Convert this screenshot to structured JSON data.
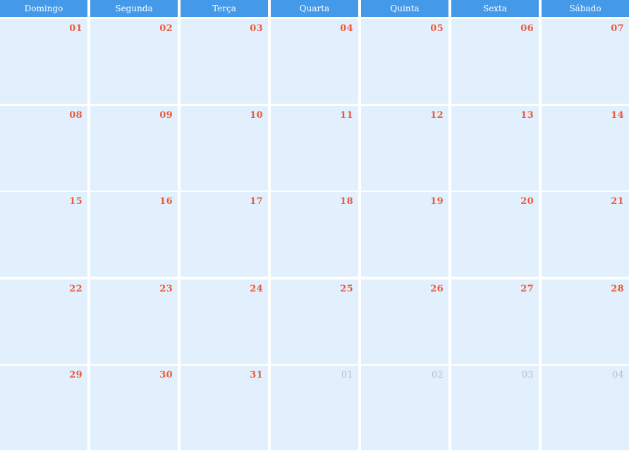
{
  "calendar": {
    "weekdays": [
      "Domingo",
      "Segunda",
      "Terça",
      "Quarta",
      "Quinta",
      "Sexta",
      "Sábado"
    ],
    "weeks": [
      {
        "days": [
          {
            "label": "01",
            "current_month": true
          },
          {
            "label": "02",
            "current_month": true
          },
          {
            "label": "03",
            "current_month": true
          },
          {
            "label": "04",
            "current_month": true
          },
          {
            "label": "05",
            "current_month": true
          },
          {
            "label": "06",
            "current_month": true
          },
          {
            "label": "07",
            "current_month": true
          }
        ]
      },
      {
        "days": [
          {
            "label": "08",
            "current_month": true
          },
          {
            "label": "09",
            "current_month": true
          },
          {
            "label": "10",
            "current_month": true
          },
          {
            "label": "11",
            "current_month": true
          },
          {
            "label": "12",
            "current_month": true
          },
          {
            "label": "13",
            "current_month": true
          },
          {
            "label": "14",
            "current_month": true
          }
        ]
      },
      {
        "days": [
          {
            "label": "15",
            "current_month": true
          },
          {
            "label": "16",
            "current_month": true
          },
          {
            "label": "17",
            "current_month": true
          },
          {
            "label": "18",
            "current_month": true
          },
          {
            "label": "19",
            "current_month": true
          },
          {
            "label": "20",
            "current_month": true
          },
          {
            "label": "21",
            "current_month": true
          }
        ]
      },
      {
        "days": [
          {
            "label": "22",
            "current_month": true
          },
          {
            "label": "23",
            "current_month": true
          },
          {
            "label": "24",
            "current_month": true
          },
          {
            "label": "25",
            "current_month": true
          },
          {
            "label": "26",
            "current_month": true
          },
          {
            "label": "27",
            "current_month": true
          },
          {
            "label": "28",
            "current_month": true
          }
        ]
      },
      {
        "days": [
          {
            "label": "29",
            "current_month": true
          },
          {
            "label": "30",
            "current_month": true
          },
          {
            "label": "31",
            "current_month": true
          },
          {
            "label": "01",
            "current_month": false
          },
          {
            "label": "02",
            "current_month": false
          },
          {
            "label": "03",
            "current_month": false
          },
          {
            "label": "04",
            "current_month": false
          }
        ]
      }
    ]
  },
  "colors": {
    "header_background": "#4499e9",
    "header_text": "#ffffff",
    "cell_background": "#e2f0fd",
    "current_month_number": "#ec5a3c",
    "other_month_number": "#b9bdc2"
  }
}
